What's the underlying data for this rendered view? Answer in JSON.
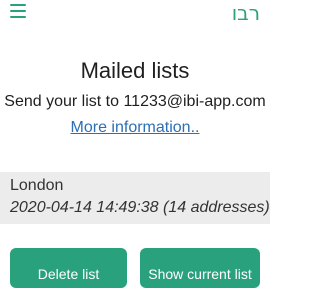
{
  "header": {
    "menu_icon": "hamburger-menu-icon",
    "menu_color": "#2aa17d",
    "language_label": "רבו"
  },
  "main": {
    "title": "Mailed lists",
    "send_instruction": "Send your list to 11233@ibi-app.com",
    "more_info_link": "More information.."
  },
  "lists": [
    {
      "city": "London",
      "details": "2020-04-14 14:49:38 (14 addresses)"
    }
  ],
  "actions": {
    "delete_label": "Delete list",
    "show_label": "Show current list"
  },
  "colors": {
    "accent": "#2aa17d",
    "link": "#2c6fb5",
    "card_background": "#ececec"
  }
}
